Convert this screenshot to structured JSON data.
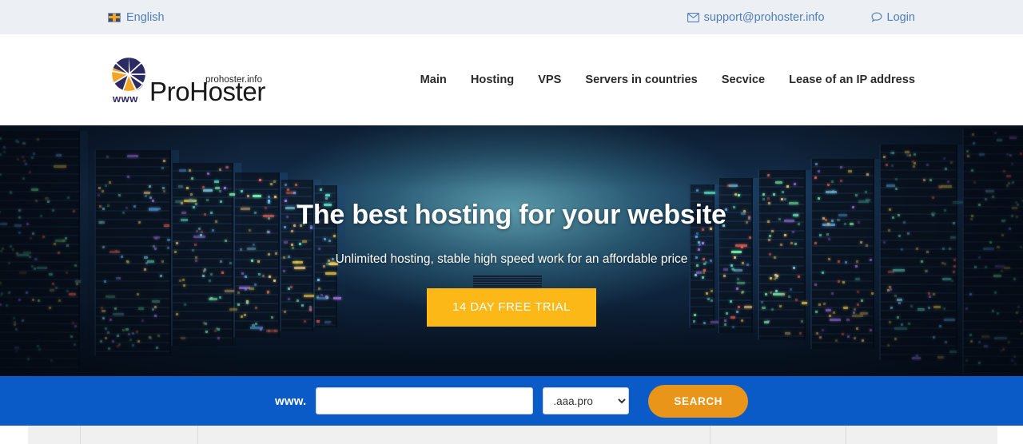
{
  "topbar": {
    "language": "English",
    "language_icon": "flag-icon",
    "email": "support@prohoster.info",
    "email_icon": "envelope-icon",
    "login": "Login",
    "login_icon": "speech-bubble-icon"
  },
  "header": {
    "logo": {
      "mark": "globe-logo-mark",
      "www": "www",
      "domain": "prohoster.info",
      "name": "ProHoster"
    },
    "nav": [
      {
        "label": "Main"
      },
      {
        "label": "Hosting"
      },
      {
        "label": "VPS"
      },
      {
        "label": "Servers in countries"
      },
      {
        "label": "Secvice"
      },
      {
        "label": "Lease of an IP address"
      }
    ]
  },
  "hero": {
    "title": "The best hosting for your website",
    "subtitle": "Unlimited hosting, stable high speed work for an affordable price",
    "cta": "14 DAY FREE TRIAL",
    "background": "server-room-photo"
  },
  "search": {
    "prefix": "www.",
    "input_value": "",
    "input_placeholder": "",
    "tld_selected": ".aaa.pro",
    "tld_options": [
      ".aaa.pro"
    ],
    "button": "SEARCH",
    "chevron_icon": "chevron-down-icon"
  },
  "colors": {
    "topbar_bg": "#eceff3",
    "link_blue": "#4d7fbd",
    "band_blue": "#0a5bc7",
    "cta_amber": "#fbb817",
    "search_orange": "#e8951a",
    "nav_text": "#2b2b2b"
  }
}
